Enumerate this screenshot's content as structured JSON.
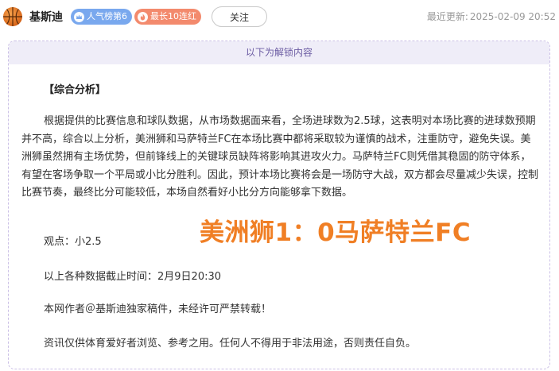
{
  "header": {
    "author_name": "基斯迪",
    "badges": {
      "popularity": "人气榜第6",
      "streak": "最长10连红"
    },
    "follow_label": "关注",
    "updated_label": "最近更新:",
    "updated_time": "2025-02-09 20:52"
  },
  "article": {
    "unlock_notice": "以下为解锁内容",
    "section_title": "【综合分析】",
    "analysis": "根据提供的比赛信息和球队数据，从市场数据面来看，全场进球数为2.5球，这表明对本场比赛的进球数预期并不高，综合以上分析，美洲狮和马萨特兰FC在本场比赛中都将采取较为谨慎的战术，注重防守，避免失误。美洲狮虽然拥有主场优势，但前锋线上的关键球员缺阵将影响其进攻火力。马萨特兰FC则凭借其稳固的防守体系，有望在客场争取一个平局或小比分胜利。因此，预计本场比赛将会是一场防守大战，双方都会尽量减少失误，控制比赛节奏，最终比分可能较低，本场自然看好小比分方向能够拿下数据。",
    "viewpoint": "观点：小2.5",
    "data_cutoff": "以上各种数据截止时间：2月9日20:30",
    "copyright": "本网作者＠基斯迪独家稿件，未经许可严禁转载！",
    "disclaimer": "资讯仅供体育爱好者浏览、参考之用。任何人不得用于非法用途，否则责任自负。"
  },
  "score_overlay": "美洲狮1：0马萨特兰FC",
  "colors": {
    "accent_orange": "#f07f25",
    "badge_blue": "#79a8ee",
    "badge_red": "#f38a6d",
    "unlock_purple": "#6c5da3"
  },
  "icons": {
    "avatar": "basketball-avatar",
    "popularity": "crown-icon",
    "streak": "flame-icon"
  }
}
